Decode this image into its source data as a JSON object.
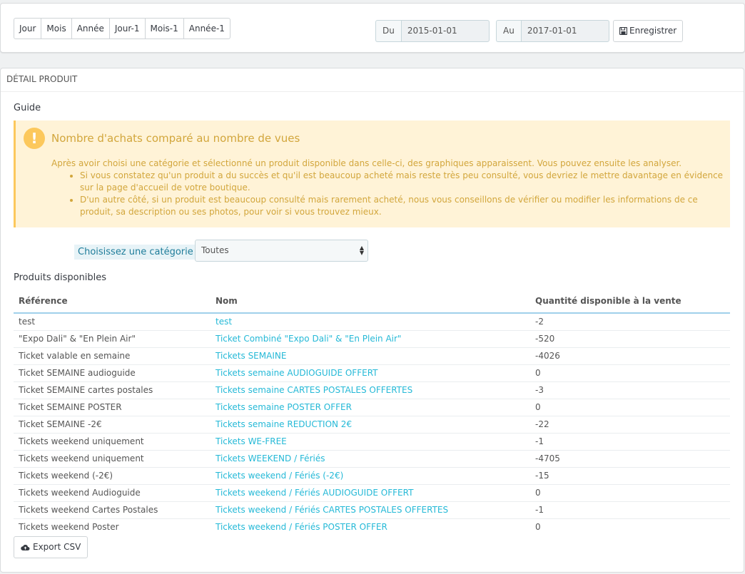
{
  "date_panel": {
    "periods": [
      "Jour",
      "Mois",
      "Année",
      "Jour-1",
      "Mois-1",
      "Année-1"
    ],
    "from_label": "Du",
    "from_value": "2015-01-01",
    "to_label": "Au",
    "to_value": "2017-01-01",
    "save_label": "Enregistrer"
  },
  "panel": {
    "heading": "DÉTAIL PRODUIT",
    "guide_title": "Guide",
    "alert": {
      "title": "Nombre d'achats comparé au nombre de vues",
      "intro": "Après avoir choisi une catégorie et sélectionné un produit disponible dans celle-ci, des graphiques apparaissent. Vous pouvez ensuite les analyser.",
      "bullets": [
        "Si vous constatez qu'un produit a du succès et qu'il est beaucoup acheté mais reste très peu consulté, vous devriez le mettre davantage en évidence sur la page d'accueil de votre boutique.",
        "D'un autre côté, si un produit est beaucoup consulté mais rarement acheté, nous vous conseillons de vérifier ou modifier les informations de ce produit, sa description ou ses photos, pour voir si vous trouvez mieux."
      ]
    },
    "category_label": "Choisissez une catégorie",
    "category_value": "Toutes",
    "products_title": "Produits disponibles",
    "columns": [
      "Référence",
      "Nom",
      "Quantité disponible à la vente"
    ],
    "rows": [
      [
        "test",
        "test",
        "-2"
      ],
      [
        "\"Expo Dali\" & \"En Plein Air\"",
        "Ticket Combiné \"Expo Dali\" & \"En Plein Air\"",
        "-520"
      ],
      [
        "Ticket valable en semaine",
        "Tickets SEMAINE",
        "-4026"
      ],
      [
        "Ticket SEMAINE audioguide",
        "Tickets semaine AUDIOGUIDE OFFERT",
        "0"
      ],
      [
        "Ticket SEMAINE cartes postales",
        "Tickets semaine CARTES POSTALES OFFERTES",
        "-3"
      ],
      [
        "Ticket SEMAINE POSTER",
        "Tickets semaine POSTER OFFER",
        "0"
      ],
      [
        "Ticket SEMAINE -2€",
        "Tickets semaine REDUCTION 2€",
        "-22"
      ],
      [
        "Tickets weekend uniquement",
        "Tickets WE-FREE",
        "-1"
      ],
      [
        "Tickets weekend uniquement",
        "Tickets WEEKEND / Fériés",
        "-4705"
      ],
      [
        "Tickets weekend (-2€)",
        "Tickets weekend / Fériés (-2€)",
        "-15"
      ],
      [
        "Tickets weekend Audioguide",
        "Tickets weekend / Fériés AUDIOGUIDE OFFERT",
        "0"
      ],
      [
        "Tickets weekend Cartes Postales",
        "Tickets weekend / Fériés CARTES POSTALES OFFERTES",
        "-1"
      ],
      [
        "Tickets weekend Poster",
        "Tickets weekend / Fériés POSTER OFFER",
        "0"
      ]
    ],
    "export_label": "Export CSV"
  },
  "icons": {
    "save": "floppy-disk-icon",
    "export": "cloud-upload-icon",
    "alert": "exclamation-icon"
  },
  "colors": {
    "link": "#25b9d7",
    "alert_bg": "#fff3d7",
    "alert_text": "#d2a63c"
  }
}
